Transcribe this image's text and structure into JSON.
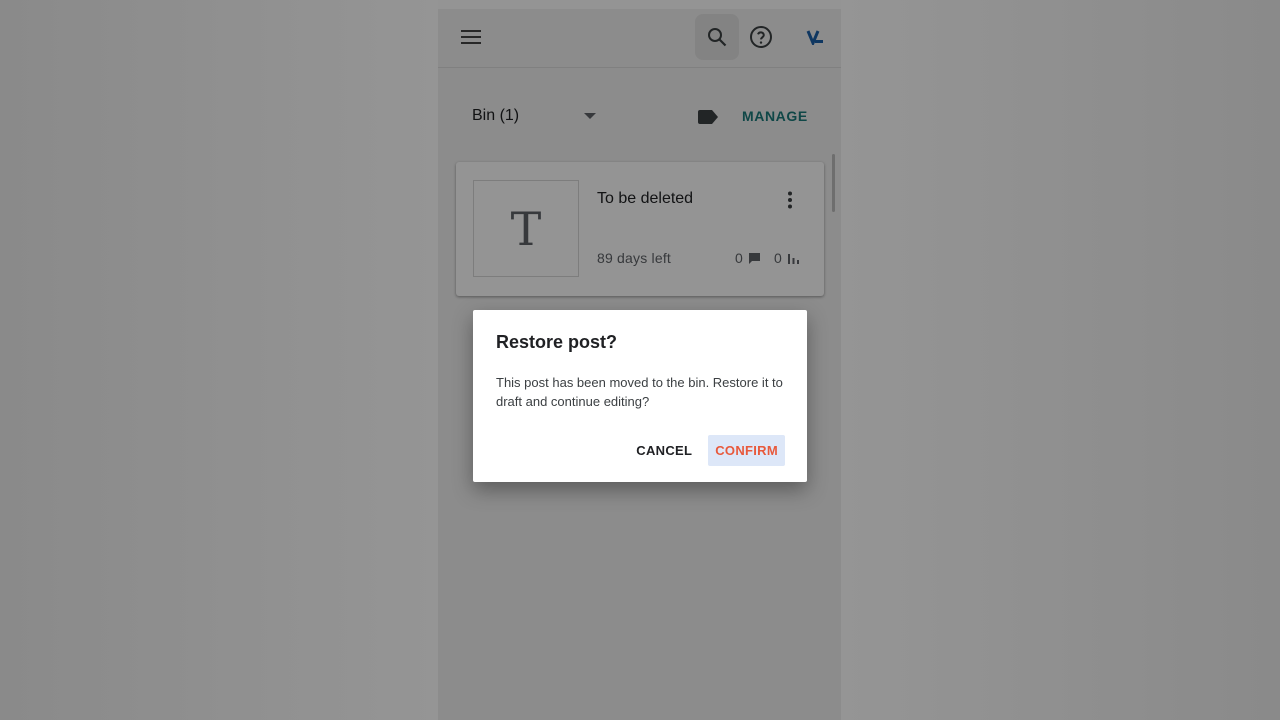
{
  "colors": {
    "accent_teal": "#1a7a7a",
    "confirm_text": "#e8593c",
    "confirm_bg": "#dde7f8"
  },
  "app_bar": {
    "menu_icon": "hamburger-menu-icon",
    "search_icon": "search-icon",
    "help_icon": "help-circle-icon",
    "avatar_icon": "blogger-avatar-icon"
  },
  "toolbar": {
    "bin_label": "Bin (1)",
    "label_icon": "label-tag-icon",
    "manage_label": "MANAGE"
  },
  "post": {
    "thumb_letter": "T",
    "title": "To be deleted",
    "days_left": "89 days left",
    "comments": "0",
    "views": "0"
  },
  "dialog": {
    "title": "Restore post?",
    "body": "This post has been moved to the bin. Restore it to draft and continue editing?",
    "cancel_label": "CANCEL",
    "confirm_label": "CONFIRM"
  }
}
